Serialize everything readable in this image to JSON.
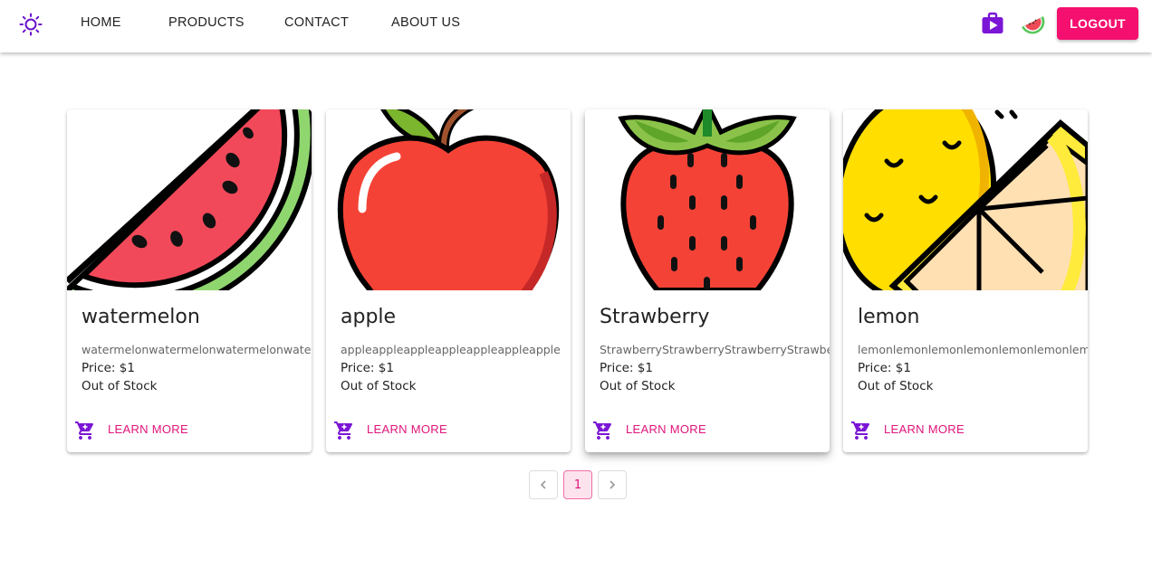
{
  "nav": {
    "items": [
      "HOME",
      "PRODUCTS",
      "CONTACT",
      "ABOUT US"
    ],
    "logout": "LOGOUT"
  },
  "icons": {
    "theme": "sun-icon",
    "store": "play-bag-icon",
    "avatar": "watermelon-avatar-icon",
    "cart": "add-cart-icon",
    "prev": "chevron-left-icon",
    "next": "chevron-right-icon"
  },
  "colors": {
    "primary": "#f50f6f",
    "accent": "#6a11cb",
    "link": "#e0147a"
  },
  "products": [
    {
      "name": "watermelon",
      "description": "watermelonwatermelonwatermelonwatermelon",
      "price": "Price: $1",
      "stock": "Out of Stock",
      "action": "LEARN MORE"
    },
    {
      "name": "apple",
      "description": "appleappleappleappleappleappleapple",
      "price": "Price: $1",
      "stock": "Out of Stock",
      "action": "LEARN MORE"
    },
    {
      "name": "Strawberry",
      "description": "StrawberryStrawberryStrawberryStrawberry",
      "price": "Price: $1",
      "stock": "Out of Stock",
      "action": "LEARN MORE"
    },
    {
      "name": "lemon",
      "description": "lemonlemonlemonlemonlemonlemonlemon",
      "price": "Price: $1",
      "stock": "Out of Stock",
      "action": "LEARN MORE"
    }
  ],
  "pagination": {
    "current": "1"
  }
}
